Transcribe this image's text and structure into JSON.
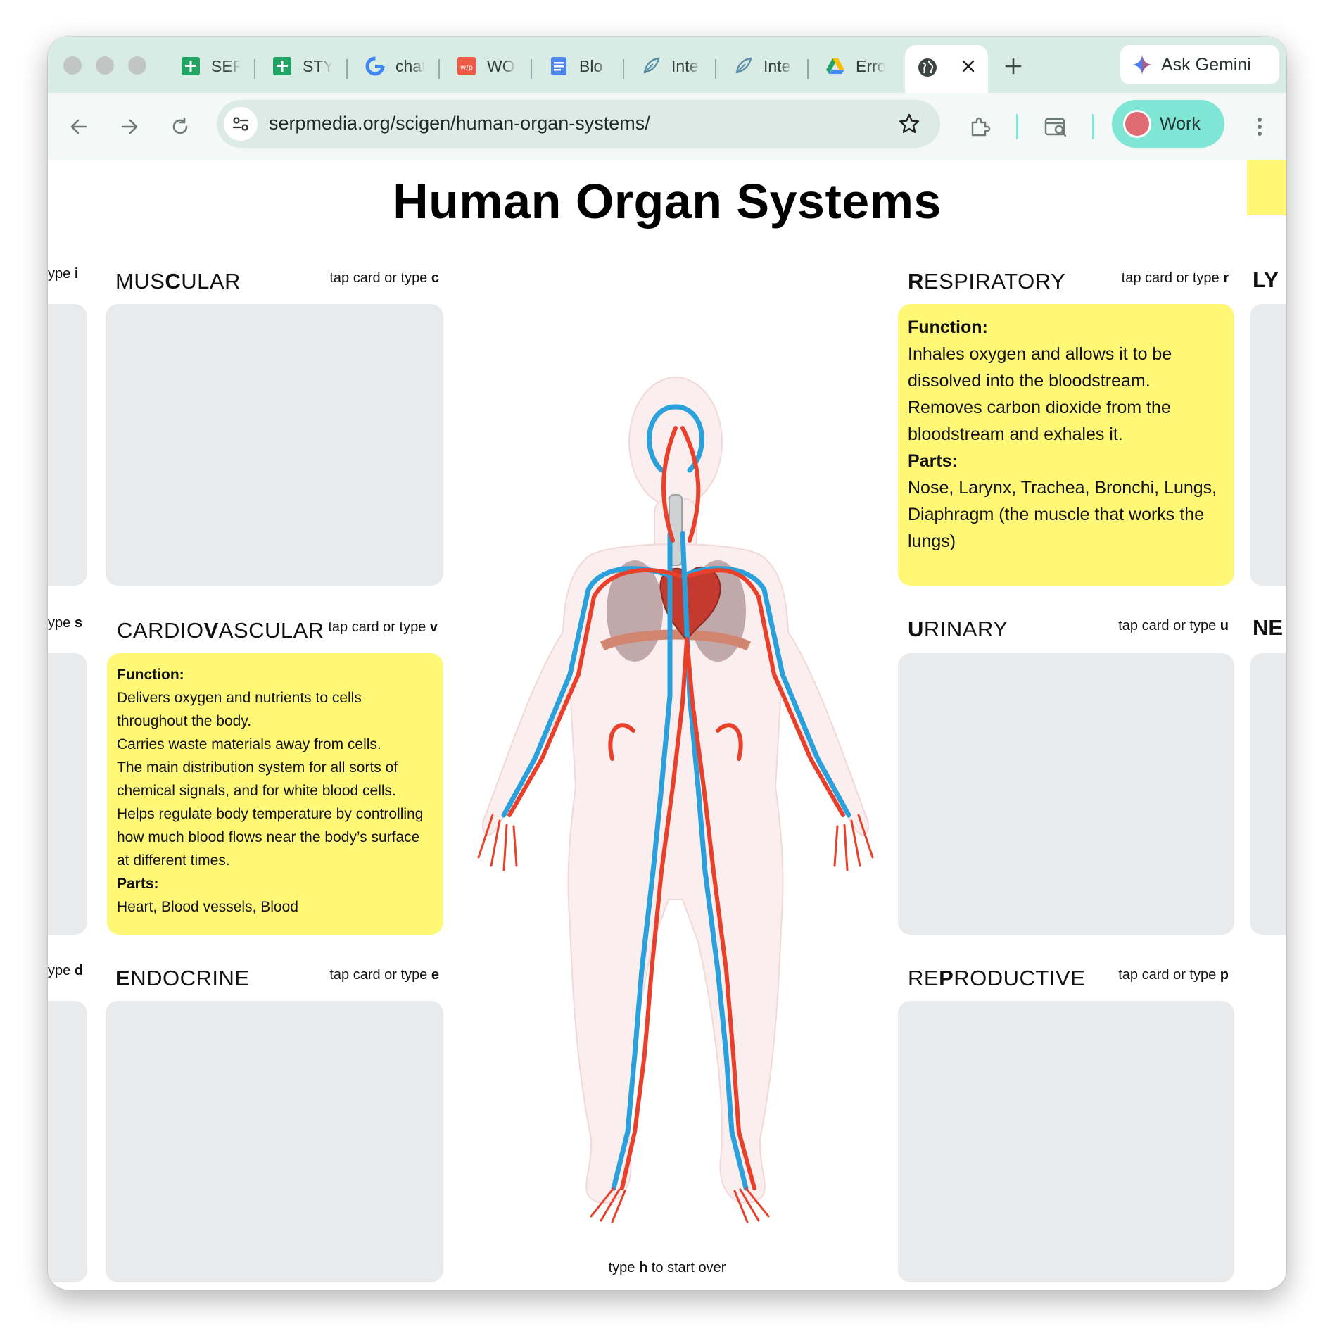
{
  "browser": {
    "tabs": [
      {
        "title": "SERP",
        "icon": "google-sheets-icon"
      },
      {
        "title": "STY",
        "icon": "google-sheets-icon"
      },
      {
        "title": "chat",
        "icon": "google-icon"
      },
      {
        "title": "WO",
        "icon": "wp-icon"
      },
      {
        "title": "Blo",
        "icon": "google-docs-icon"
      },
      {
        "title": "Inte",
        "icon": "leaf-icon"
      },
      {
        "title": "Inte",
        "icon": "leaf-icon"
      },
      {
        "title": "Erro",
        "icon": "google-drive-icon"
      }
    ],
    "active_tab_icon": "globe-icon",
    "gemini_label": "Ask Gemini",
    "url": "serpmedia.org/scigen/human-organ-systems/",
    "profile_label": "Work",
    "accent": "#7fe5d4"
  },
  "page": {
    "title": "Human Organ Systems",
    "hint_prefix": "tap card or type",
    "edge_left": [
      {
        "text": "ype",
        "key": "i"
      },
      {
        "text": "ype",
        "key": "s"
      },
      {
        "text": "ype",
        "key": "d"
      }
    ],
    "edge_right": [
      "LY",
      "NE"
    ],
    "cards": {
      "muscular": {
        "pre": "MUS",
        "key_letter": "C",
        "post": "ULAR",
        "key": "c"
      },
      "cardiovascular": {
        "pre": "CARDIO",
        "key_letter": "V",
        "post": "ASCULAR",
        "key": "v",
        "function_heading": "Function:",
        "function_lines": [
          "Delivers oxygen and nutrients to cells throughout the body.",
          "Carries waste materials away from cells.",
          "The main distribution system for all sorts of chemical signals, and for white blood cells.",
          "Helps regulate body temperature by controlling how much blood flows near the body’s surface at different times."
        ],
        "parts_heading": "Parts:",
        "parts": "Heart, Blood vessels, Blood"
      },
      "endocrine": {
        "pre": "",
        "key_letter": "E",
        "post": "NDOCRINE",
        "key": "e"
      },
      "respiratory": {
        "pre": "",
        "key_letter": "R",
        "post": "ESPIRATORY",
        "key": "r",
        "function_heading": "Function:",
        "function_lines": [
          "Inhales oxygen and allows it to be dissolved into the bloodstream.",
          "Removes carbon dioxide from the bloodstream and exhales it."
        ],
        "parts_heading": "Parts:",
        "parts": "Nose, Larynx, Trachea, Bronchi, Lungs, Diaphragm (the muscle that works the lungs)"
      },
      "urinary": {
        "pre": "",
        "key_letter": "U",
        "post": "RINARY",
        "key": "u"
      },
      "reproductive": {
        "pre": "RE",
        "key_letter": "P",
        "post": "RODUCTIVE",
        "key": "p"
      }
    },
    "footer": {
      "pre": "type",
      "key": "h",
      "post": "to start over"
    },
    "colors": {
      "card_open": "#fff877",
      "card_closed": "#e9eaeb",
      "artery": "#e8402a",
      "vein": "#2aa0dc"
    }
  }
}
